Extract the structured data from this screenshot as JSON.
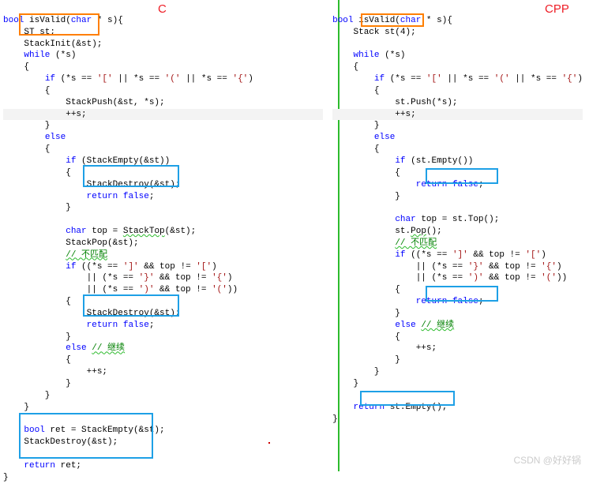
{
  "labels": {
    "c": "C",
    "cpp": "CPP"
  },
  "watermark": "CSDN @好好锅",
  "left": {
    "l1a": "bool",
    "l1b": " isValid(",
    "l1c": "char",
    "l1d": " * s){",
    "l2": "    ST st;",
    "l3": "    StackInit(&st);",
    "l4a": "    ",
    "l4b": "while",
    "l4c": " (*s)",
    "l5": "    {",
    "l6a": "        ",
    "l6b": "if",
    "l6c": " (*s == ",
    "l6d": "'['",
    "l6e": " || *s == ",
    "l6f": "'('",
    "l6g": " || *s == ",
    "l6h": "'{'",
    "l6i": ")",
    "l7": "        {",
    "l8": "            StackPush(&st, *s);",
    "l9": "            ++s;",
    "l10": "        }",
    "l11a": "        ",
    "l11b": "else",
    "l12": "        {",
    "l13a": "            ",
    "l13b": "if",
    "l13c": " (StackEmpty(&st))",
    "l14": "            {",
    "l15": "                StackDestroy(&st);",
    "l16a": "                ",
    "l16b": "return",
    "l16c": " ",
    "l16d": "false",
    "l16e": ";",
    "l17": "            }",
    "l18": " ",
    "l19a": "            ",
    "l19b": "char",
    "l19c": " top = ",
    "l19d": "StackTop",
    "l19e": "(&st);",
    "l20": "            StackPop(&st);",
    "l21a": "            ",
    "l21b": "// 不匹配",
    "l22a": "            ",
    "l22b": "if",
    "l22c": " ((*s == ",
    "l22d": "']'",
    "l22e": " && top != ",
    "l22f": "'['",
    "l22g": ")",
    "l23a": "                || (*s == ",
    "l23b": "'}'",
    "l23c": " && top != ",
    "l23d": "'{'",
    "l23e": ")",
    "l24a": "                || (*s == ",
    "l24b": "')'",
    "l24c": " && top != ",
    "l24d": "'('",
    "l24e": "))",
    "l25": "            {",
    "l26": "                StackDestroy(&st);",
    "l27a": "                ",
    "l27b": "return",
    "l27c": " ",
    "l27d": "false",
    "l27e": ";",
    "l28": "            }",
    "l29a": "            ",
    "l29b": "else",
    "l29c": " ",
    "l29d": "// 继续",
    "l30": "            {",
    "l31": "                ++s;",
    "l32": "            }",
    "l33": "        }",
    "l34": "    }",
    "l35": " ",
    "l36a": "    ",
    "l36b": "bool",
    "l36c": " ret = StackEmpty(&st);",
    "l37": "    StackDestroy(&st);",
    "l38": " ",
    "l39a": "    ",
    "l39b": "return",
    "l39c": " ret;",
    "l40": "}"
  },
  "right": {
    "l1a": "bool",
    "l1b": " isValid(",
    "l1c": "char",
    "l1d": " * s){",
    "l2a": "    Stack st(",
    "l2b": "4",
    "l2c": ");",
    "l3": " ",
    "l4a": "    ",
    "l4b": "while",
    "l4c": " (*s)",
    "l5": "    {",
    "l6a": "        ",
    "l6b": "if",
    "l6c": " (*s == ",
    "l6d": "'['",
    "l6e": " || *s == ",
    "l6f": "'('",
    "l6g": " || *s == ",
    "l6h": "'{'",
    "l6i": ")",
    "l7": "        {",
    "l8": "            st.Push(*s);",
    "l9": "            ++s;",
    "l10": "        }",
    "l11a": "        ",
    "l11b": "else",
    "l12": "        {",
    "l13a": "            ",
    "l13b": "if",
    "l13c": " (st.Empty())",
    "l14": "            {",
    "l15a": "                ",
    "l15b": "return",
    "l15c": " ",
    "l15d": "false",
    "l15e": ";",
    "l16": "            }",
    "l17": " ",
    "l18a": "            ",
    "l18b": "char",
    "l18c": " top = st.Top();",
    "l19a": "            st.",
    "l19b": "Pop",
    "l19c": "();",
    "l20a": "            ",
    "l20b": "// 不匹配",
    "l21a": "            ",
    "l21b": "if",
    "l21c": " ((*s == ",
    "l21d": "']'",
    "l21e": " && top != ",
    "l21f": "'['",
    "l21g": ")",
    "l22a": "                || (*s == ",
    "l22b": "'}'",
    "l22c": " && top != ",
    "l22d": "'{'",
    "l22e": ")",
    "l23a": "                || (*s == ",
    "l23b": "')'",
    "l23c": " && top != ",
    "l23d": "'('",
    "l23e": "))",
    "l24": "            {",
    "l25a": "                ",
    "l25b": "return",
    "l25c": " ",
    "l25d": "false",
    "l25e": ";",
    "l26": "            }",
    "l27a": "            ",
    "l27b": "else",
    "l27c": " ",
    "l27d": "// 继续",
    "l28": "            {",
    "l29": "                ++s;",
    "l30": "            }",
    "l31": "        }",
    "l32": "    }",
    "l33": " ",
    "l34a": "    ",
    "l34b": "return",
    "l34c": " st.Empty();",
    "l35": "}"
  }
}
